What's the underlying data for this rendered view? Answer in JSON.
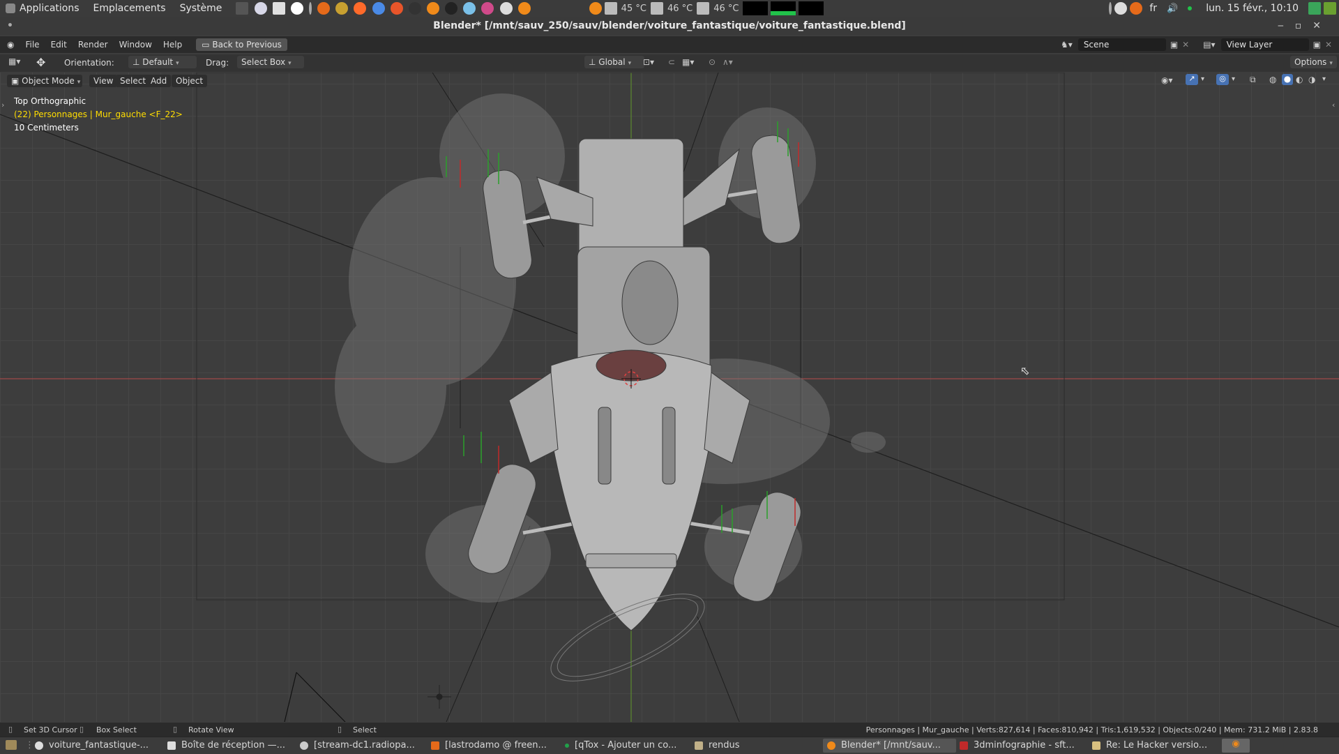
{
  "system_panel": {
    "menus": [
      "Applications",
      "Emplacements",
      "Système"
    ],
    "temps": [
      "45 °C",
      "46 °C",
      "46 °C"
    ],
    "language": "fr",
    "clock": "lun. 15 févr., 10:10"
  },
  "window": {
    "title": "Blender* [/mnt/sauv_250/sauv/blender/voiture_fantastique/voiture_fantastique.blend]"
  },
  "menubar": {
    "items": [
      "File",
      "Edit",
      "Render",
      "Window",
      "Help"
    ],
    "back_button": "Back to Previous",
    "scene_value": "Scene",
    "view_layer_value": "View Layer"
  },
  "tool_header": {
    "orientation_label": "Orientation:",
    "orientation_value": "Default",
    "drag_label": "Drag:",
    "drag_value": "Select Box",
    "transform_orientation": "Global",
    "options_label": "Options"
  },
  "viewport_header": {
    "mode": "Object Mode",
    "menus": [
      "View",
      "Select",
      "Add",
      "Object"
    ]
  },
  "viewport_overlay": {
    "view_name": "Top Orthographic",
    "collection_info": "(22) Personnages | Mur_gauche <F_22>",
    "scale": "10 Centimeters"
  },
  "statusbar": {
    "left_items": [
      "Set 3D Cursor",
      "Box Select",
      "Rotate View",
      "Select"
    ],
    "stats": "Personnages | Mur_gauche | Verts:827,614 | Faces:810,942 | Tris:1,619,532 | Objects:0/240 | Mem: 731.2 MiB | 2.83.8"
  },
  "taskbar": {
    "tasks": [
      "voiture_fantastique-...",
      "Boîte de réception —...",
      "[stream-dc1.radiopa...",
      "[lastrodamo @ freen...",
      "[qTox - Ajouter un co...",
      "rendus",
      "Blender* [/mnt/sauv...",
      "3dminfographie - sft...",
      "Re: Le Hacker versio..."
    ]
  },
  "colors": {
    "accent_blue": "#4772b3",
    "collection_text": "#ffdd00",
    "x_axis": "#b34a4a",
    "y_axis": "#6ba335",
    "ui_dark": "#2b2b2b"
  }
}
